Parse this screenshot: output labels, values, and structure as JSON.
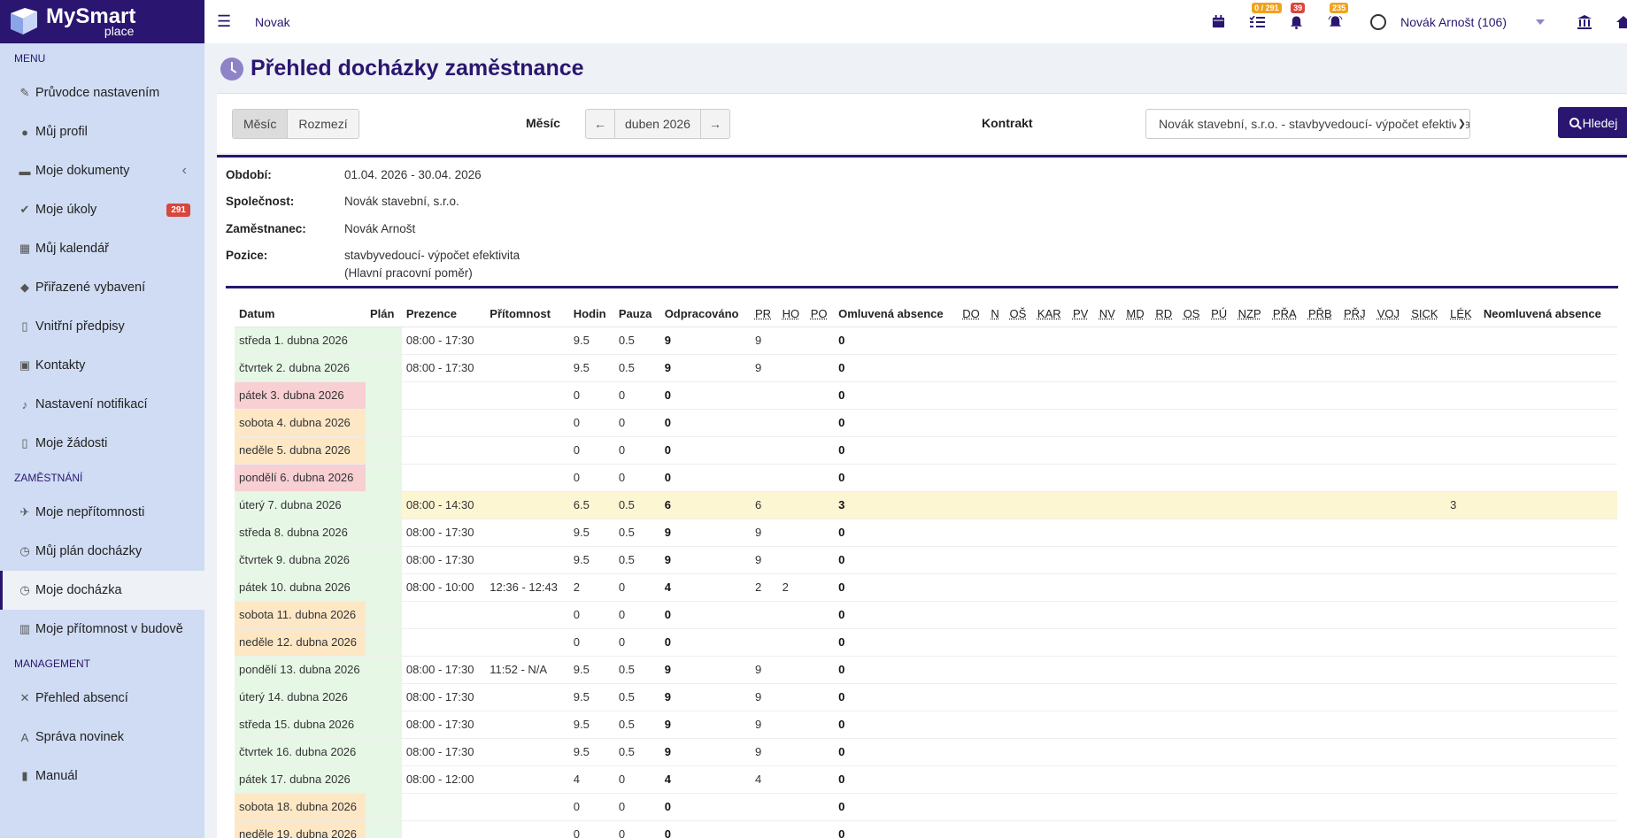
{
  "app": {
    "logo_line1": "MySmart",
    "logo_line2": "place"
  },
  "topbar": {
    "title": "Novak",
    "tasks_badge": "0 / 291",
    "notif_badge": "39",
    "alerts_badge": "235",
    "user_name": "Novák Arnošt (106)"
  },
  "sidebar": {
    "menu_label": "MENU",
    "menu_items": [
      {
        "label": "Průvodce nastavením",
        "icon": "pencil-icon"
      },
      {
        "label": "Můj profil",
        "icon": "user-icon"
      },
      {
        "label": "Moje dokumenty",
        "icon": "folder-icon"
      },
      {
        "label": "Moje úkoly",
        "icon": "check-circle-icon",
        "badge": "291"
      },
      {
        "label": "Můj kalendář",
        "icon": "calendar-icon"
      },
      {
        "label": "Přiřazené vybavení",
        "icon": "gem-icon"
      },
      {
        "label": "Vnitřní předpisy",
        "icon": "file-icon"
      },
      {
        "label": "Kontakty",
        "icon": "contact-card-icon"
      },
      {
        "label": "Nastavení notifikací",
        "icon": "bell-icon"
      },
      {
        "label": "Moje žádosti",
        "icon": "file-icon"
      }
    ],
    "employment_label": "ZAMĚSTNÁNÍ",
    "employment_items": [
      {
        "label": "Moje nepřítomnosti",
        "icon": "plane-icon"
      },
      {
        "label": "Můj plán docházky",
        "icon": "clock-icon"
      },
      {
        "label": "Moje docházka",
        "icon": "clock-icon"
      },
      {
        "label": "Moje přítomnost v budově",
        "icon": "building-icon"
      }
    ],
    "management_label": "MANAGEMENT",
    "management_items": [
      {
        "label": "Přehled absencí",
        "icon": "user-x-icon"
      },
      {
        "label": "Správa novinek",
        "icon": "font-icon"
      },
      {
        "label": "Manuál",
        "icon": "book-icon"
      }
    ]
  },
  "page": {
    "title": "Přehled docházky zaměstnance"
  },
  "filter": {
    "seg_month": "Měsíc",
    "seg_range": "Rozmezí",
    "month_label": "Měsíc",
    "month_value": "duben 2026",
    "contract_label": "Kontrakt",
    "contract_value": "Novák stavební, s.r.o. - stavbyvedoucí- výpočet efektivita H",
    "search_label": "Hledej"
  },
  "info": {
    "period_label": "Období:",
    "period_value": "01.04. 2026 - 30.04. 2026",
    "company_label": "Společnost:",
    "company_value": "Novák stavební, s.r.o.",
    "employee_label": "Zaměstnanec:",
    "employee_value": "Novák Arnošt",
    "position_label": "Pozice:",
    "position_value": "stavbyvedoucí- výpočet efektivita",
    "position_note": "(Hlavní pracovní poměr)"
  },
  "table": {
    "columns": [
      "Datum",
      "Plán",
      "Prezence",
      "Přítomnost",
      "Hodin",
      "Pauza",
      "Odpracováno",
      "PR",
      "HO",
      "PO",
      "Omluvená absence",
      "DO",
      "N",
      "OŠ",
      "KAR",
      "PV",
      "NV",
      "MD",
      "RD",
      "OS",
      "PÚ",
      "NZP",
      "PŘA",
      "PŘB",
      "PŘJ",
      "VOJ",
      "SICK",
      "LÉK",
      "Neomluvená absence"
    ],
    "rows": [
      {
        "type": "work",
        "date": "středa 1. dubna 2026",
        "prezence": "08:00 - 17:30",
        "pritomnost": "",
        "hodin": "9.5",
        "pauza": "0.5",
        "odprac": "9",
        "pr": "9",
        "ho": "",
        "omluv": "0",
        "lek": ""
      },
      {
        "type": "work",
        "date": "čtvrtek 2. dubna 2026",
        "prezence": "08:00 - 17:30",
        "pritomnost": "",
        "hodin": "9.5",
        "pauza": "0.5",
        "odprac": "9",
        "pr": "9",
        "ho": "",
        "omluv": "0",
        "lek": ""
      },
      {
        "type": "holiday",
        "date": "pátek 3. dubna 2026",
        "prezence": "",
        "pritomnost": "",
        "hodin": "0",
        "pauza": "0",
        "odprac": "0",
        "pr": "",
        "ho": "",
        "omluv": "0",
        "lek": ""
      },
      {
        "type": "weekend",
        "date": "sobota 4. dubna 2026",
        "prezence": "",
        "pritomnost": "",
        "hodin": "0",
        "pauza": "0",
        "odprac": "0",
        "pr": "",
        "ho": "",
        "omluv": "0",
        "lek": ""
      },
      {
        "type": "weekend",
        "date": "neděle 5. dubna 2026",
        "prezence": "",
        "pritomnost": "",
        "hodin": "0",
        "pauza": "0",
        "odprac": "0",
        "pr": "",
        "ho": "",
        "omluv": "0",
        "lek": ""
      },
      {
        "type": "holiday",
        "date": "pondělí 6. dubna 2026",
        "prezence": "",
        "pritomnost": "",
        "hodin": "0",
        "pauza": "0",
        "odprac": "0",
        "pr": "",
        "ho": "",
        "omluv": "0",
        "lek": ""
      },
      {
        "type": "highlight",
        "date": "úterý 7. dubna 2026",
        "prezence": "08:00 - 14:30",
        "pritomnost": "",
        "hodin": "6.5",
        "pauza": "0.5",
        "odprac": "6",
        "pr": "6",
        "ho": "",
        "omluv": "3",
        "lek": "3"
      },
      {
        "type": "work",
        "date": "středa 8. dubna 2026",
        "prezence": "08:00 - 17:30",
        "pritomnost": "",
        "hodin": "9.5",
        "pauza": "0.5",
        "odprac": "9",
        "pr": "9",
        "ho": "",
        "omluv": "0",
        "lek": ""
      },
      {
        "type": "work",
        "date": "čtvrtek 9. dubna 2026",
        "prezence": "08:00 - 17:30",
        "pritomnost": "",
        "hodin": "9.5",
        "pauza": "0.5",
        "odprac": "9",
        "pr": "9",
        "ho": "",
        "omluv": "0",
        "lek": ""
      },
      {
        "type": "work",
        "date": "pátek 10. dubna 2026",
        "prezence": "08:00 - 10:00",
        "pritomnost": "12:36 - 12:43",
        "hodin": "2",
        "pauza": "0",
        "odprac": "4",
        "pr": "2",
        "ho": "2",
        "omluv": "0",
        "lek": ""
      },
      {
        "type": "weekend",
        "date": "sobota 11. dubna 2026",
        "prezence": "",
        "pritomnost": "",
        "hodin": "0",
        "pauza": "0",
        "odprac": "0",
        "pr": "",
        "ho": "",
        "omluv": "0",
        "lek": ""
      },
      {
        "type": "weekend",
        "date": "neděle 12. dubna 2026",
        "prezence": "",
        "pritomnost": "",
        "hodin": "0",
        "pauza": "0",
        "odprac": "0",
        "pr": "",
        "ho": "",
        "omluv": "0",
        "lek": ""
      },
      {
        "type": "work",
        "date": "pondělí 13. dubna 2026",
        "prezence": "08:00 - 17:30",
        "pritomnost": "11:52 - N/A",
        "hodin": "9.5",
        "pauza": "0.5",
        "odprac": "9",
        "pr": "9",
        "ho": "",
        "omluv": "0",
        "lek": ""
      },
      {
        "type": "work",
        "date": "úterý 14. dubna 2026",
        "prezence": "08:00 - 17:30",
        "pritomnost": "",
        "hodin": "9.5",
        "pauza": "0.5",
        "odprac": "9",
        "pr": "9",
        "ho": "",
        "omluv": "0",
        "lek": ""
      },
      {
        "type": "work",
        "date": "středa 15. dubna 2026",
        "prezence": "08:00 - 17:30",
        "pritomnost": "",
        "hodin": "9.5",
        "pauza": "0.5",
        "odprac": "9",
        "pr": "9",
        "ho": "",
        "omluv": "0",
        "lek": ""
      },
      {
        "type": "work",
        "date": "čtvrtek 16. dubna 2026",
        "prezence": "08:00 - 17:30",
        "pritomnost": "",
        "hodin": "9.5",
        "pauza": "0.5",
        "odprac": "9",
        "pr": "9",
        "ho": "",
        "omluv": "0",
        "lek": ""
      },
      {
        "type": "work",
        "date": "pátek 17. dubna 2026",
        "prezence": "08:00 - 12:00",
        "pritomnost": "",
        "hodin": "4",
        "pauza": "0",
        "odprac": "4",
        "pr": "4",
        "ho": "",
        "omluv": "0",
        "lek": ""
      },
      {
        "type": "weekend",
        "date": "sobota 18. dubna 2026",
        "prezence": "",
        "pritomnost": "",
        "hodin": "0",
        "pauza": "0",
        "odprac": "0",
        "pr": "",
        "ho": "",
        "omluv": "0",
        "lek": ""
      },
      {
        "type": "weekend",
        "date": "neděle 19. dubna 2026",
        "prezence": "",
        "pritomnost": "",
        "hodin": "0",
        "pauza": "0",
        "odprac": "0",
        "pr": "",
        "ho": "",
        "omluv": "0",
        "lek": ""
      }
    ]
  },
  "colors": {
    "brand": "#2a1670",
    "sidebar_bg": "#cfdcf3",
    "work_bg": "#e6f7e6",
    "holiday_bg": "#f8cfd2",
    "weekend_bg": "#fde7c5",
    "highlight_bg": "#fdf6d3"
  }
}
